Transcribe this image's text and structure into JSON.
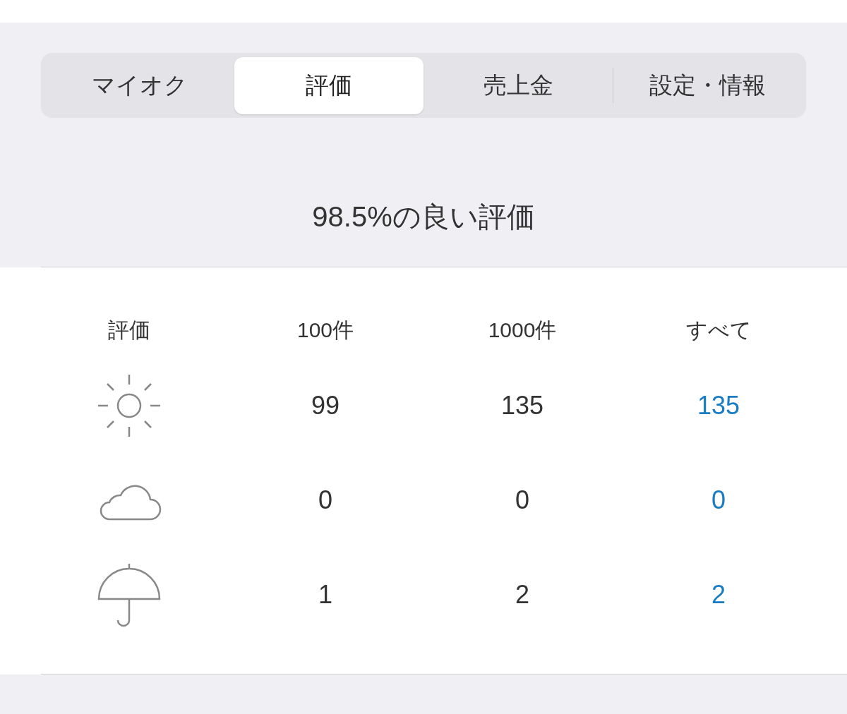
{
  "tabs": [
    {
      "label": "マイオク",
      "selected": false
    },
    {
      "label": "評価",
      "selected": true
    },
    {
      "label": "売上金",
      "selected": false
    },
    {
      "label": "設定・情報",
      "selected": false
    }
  ],
  "summary": "98.5%の良い評価",
  "table": {
    "columns": [
      "評価",
      "100件",
      "1000件",
      "すべて"
    ],
    "rows": [
      {
        "kind": "sun",
        "values": [
          "99",
          "135",
          "135"
        ]
      },
      {
        "kind": "cloud",
        "values": [
          "0",
          "0",
          "0"
        ]
      },
      {
        "kind": "umbrella",
        "values": [
          "1",
          "2",
          "2"
        ]
      }
    ]
  }
}
